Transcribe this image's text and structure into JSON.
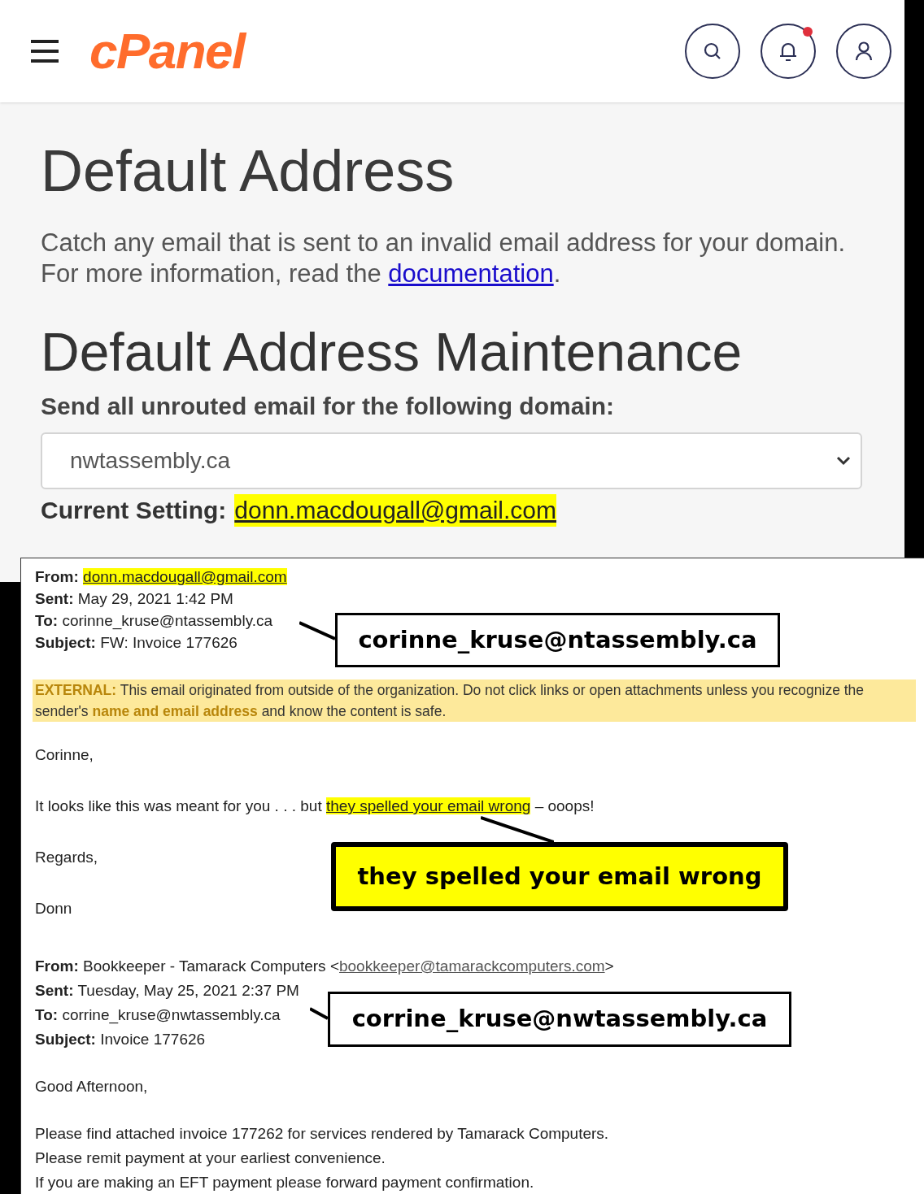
{
  "header": {
    "logo": "cPanel",
    "has_notification": true
  },
  "page": {
    "title": "Default Address",
    "intro": "Catch any email that is sent to an invalid email address for your domain.",
    "more_info": {
      "before": "For more information, read the ",
      "link": "documentation",
      "after": "."
    },
    "section_title": "Default Address Maintenance",
    "domain_label": "Send all unrouted email for the following domain:",
    "domain_select": {
      "value": "nwtassembly.ca"
    },
    "current_setting": {
      "label": "Current Setting:",
      "value": "donn.macdougall@gmail.com"
    }
  },
  "emails": [
    {
      "headers": [
        {
          "label": "From:",
          "parts": [
            {
              "text": "donn.macdougall@gmail.com",
              "kind": "highlight"
            }
          ]
        },
        {
          "label": "Sent:",
          "parts": [
            {
              "text": "May 29, 2021 1:42 PM",
              "kind": "plain"
            }
          ]
        },
        {
          "label": "To:",
          "parts": [
            {
              "text": "corinne_kruse@ntassembly.ca",
              "kind": "plain"
            }
          ]
        },
        {
          "label": "Subject:",
          "parts": [
            {
              "text": "FW: Invoice 177626",
              "kind": "plain"
            }
          ]
        }
      ],
      "banner": [
        {
          "text": "EXTERNAL:",
          "kind": "accent"
        },
        {
          "text": " This email originated from outside of the organization. Do not click links or open attachments unless you recognize the sender's ",
          "kind": "plain"
        },
        {
          "text": "name and email address",
          "kind": "accent"
        },
        {
          "text": " and know the content is safe.",
          "kind": "plain"
        }
      ],
      "body": [
        [
          [
            {
              "text": "Corinne,",
              "kind": "plain"
            }
          ]
        ],
        [
          [
            {
              "text": "It looks like this was meant for you . . . but ",
              "kind": "plain"
            },
            {
              "text": "they spelled your email wrong",
              "kind": "highlight"
            },
            {
              "text": " – ooops!",
              "kind": "plain"
            }
          ]
        ],
        [
          [
            {
              "text": "Regards,",
              "kind": "plain"
            }
          ]
        ],
        [
          [
            {
              "text": "Donn",
              "kind": "plain"
            }
          ]
        ]
      ]
    },
    {
      "headers": [
        {
          "label": "From:",
          "parts": [
            {
              "text": "Bookkeeper - Tamarack Computers <",
              "kind": "plain"
            },
            {
              "text": "bookkeeper@tamarackcomputers.com",
              "kind": "link"
            },
            {
              "text": ">",
              "kind": "plain"
            }
          ]
        },
        {
          "label": "Sent:",
          "parts": [
            {
              "text": "Tuesday, May 25, 2021 2:37 PM",
              "kind": "plain"
            }
          ]
        },
        {
          "label": "To:",
          "parts": [
            {
              "text": "corrine_kruse@nwtassembly.ca",
              "kind": "plain"
            }
          ]
        },
        {
          "label": "Subject:",
          "parts": [
            {
              "text": "Invoice 177626",
              "kind": "plain"
            }
          ]
        }
      ],
      "body": [
        [
          [
            {
              "text": "Good Afternoon,",
              "kind": "plain"
            }
          ]
        ],
        [
          [
            {
              "text": "Please find attached invoice 177262 for services rendered by Tamarack Computers.",
              "kind": "plain"
            }
          ],
          [
            {
              "text": "Please remit payment at your earliest convenience.",
              "kind": "plain"
            }
          ],
          [
            {
              "text": "If you are making an EFT payment please forward payment confirmation.",
              "kind": "plain"
            }
          ]
        ]
      ]
    }
  ],
  "callouts": [
    {
      "text": "corinne_kruse@ntassembly.ca",
      "highlighted": false
    },
    {
      "text": "they spelled your email wrong",
      "highlighted": true
    },
    {
      "text": "corrine_kruse@nwtassembly.ca",
      "highlighted": false
    }
  ]
}
